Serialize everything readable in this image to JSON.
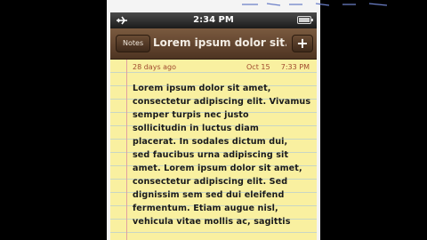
{
  "status_bar": {
    "time": "2:34 PM",
    "airplane_icon": "airplane-icon",
    "battery_icon": "battery-icon"
  },
  "nav_bar": {
    "back_label": "Notes",
    "title": "Lorem ipsum dolor sit...",
    "add_label": "+"
  },
  "note": {
    "age": "28 days ago",
    "date": "Oct 15",
    "time": "7:33 PM",
    "lines": [
      "Lorem ipsum dolor sit amet,",
      "consectetur adipiscing elit. Vivamus",
      "semper turpis nec justo",
      "sollicitudin in luctus diam",
      "placerat. In sodales dictum dui,",
      "sed faucibus urna adipiscing sit",
      "amet. Lorem ipsum dolor sit amet,",
      "consectetur adipiscing elit. Sed",
      "dignissim sem sed dui eleifend",
      "fermentum. Etiam augue nisl,",
      "vehicula vitae mollis ac, sagittis"
    ]
  },
  "colors": {
    "paper": "#f9f0a0",
    "nav_bar": "#5e412b",
    "date_text": "#a04a2f"
  }
}
